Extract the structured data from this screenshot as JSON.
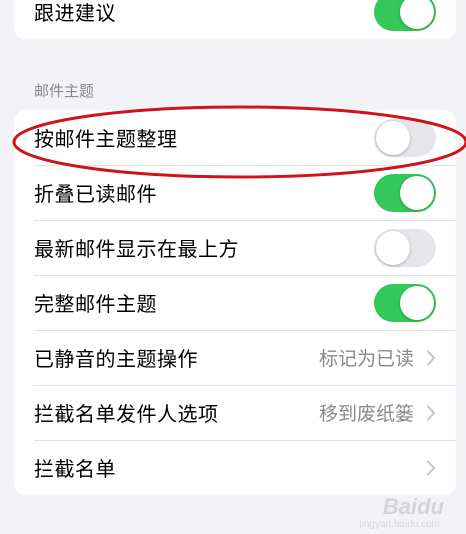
{
  "top_group": {
    "rows": [
      {
        "label": "跟进建议",
        "toggle_on": true
      }
    ]
  },
  "section_header": "邮件主题",
  "thread_group": {
    "rows": [
      {
        "label": "按邮件主题整理",
        "control": "toggle",
        "toggle_on": false
      },
      {
        "label": "折叠已读邮件",
        "control": "toggle",
        "toggle_on": true
      },
      {
        "label": "最新邮件显示在最上方",
        "control": "toggle",
        "toggle_on": false
      },
      {
        "label": "完整邮件主题",
        "control": "toggle",
        "toggle_on": true
      },
      {
        "label": "已静音的主题操作",
        "control": "nav",
        "value": "标记为已读",
        "icon": "chevron-right-icon"
      },
      {
        "label": "拦截名单发件人选项",
        "control": "nav",
        "value": "移到废纸篓",
        "icon": "chevron-right-icon"
      },
      {
        "label": "拦截名单",
        "control": "nav",
        "value": "",
        "icon": "chevron-right-icon"
      }
    ]
  },
  "annotation": {
    "shape": "ellipse",
    "color": "#d0121b",
    "target": "按邮件主题整理"
  },
  "watermark": {
    "text": "Baidu",
    "subtext": "jingyan.baidu.com"
  },
  "colors": {
    "toggle_on": "#34c759",
    "toggle_off": "#e6e6ea",
    "background": "#f2f2f7",
    "secondary_text": "#8a8a8e"
  }
}
